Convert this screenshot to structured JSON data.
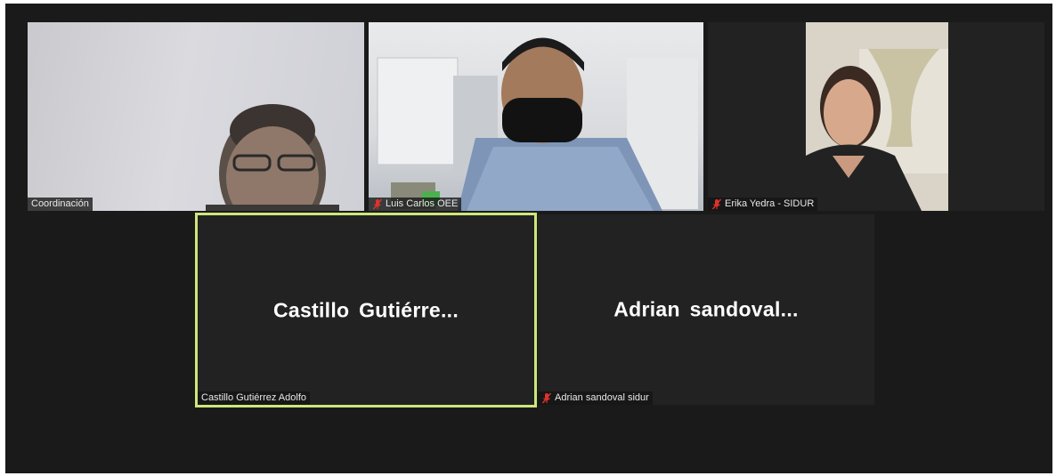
{
  "meeting": {
    "participants": [
      {
        "name": "Coordinación",
        "muted": false,
        "video": true
      },
      {
        "name": "Luis Carlos OEE",
        "muted": true,
        "video": true
      },
      {
        "name": "Erika Yedra - SIDUR",
        "muted": true,
        "video": true
      },
      {
        "name": "Castillo Gutiérrez Adolfo",
        "display": "Castillo  Gutiérre...",
        "muted": false,
        "video": false,
        "active_speaker": true
      },
      {
        "name": "Adrian sandoval sidur",
        "display": "Adrian  sandoval...",
        "muted": true,
        "video": false
      }
    ]
  },
  "colors": {
    "background": "#1a1a1a",
    "tile": "#222222",
    "active_speaker_border": "#cde77a",
    "muted_icon": "#e0322b"
  }
}
